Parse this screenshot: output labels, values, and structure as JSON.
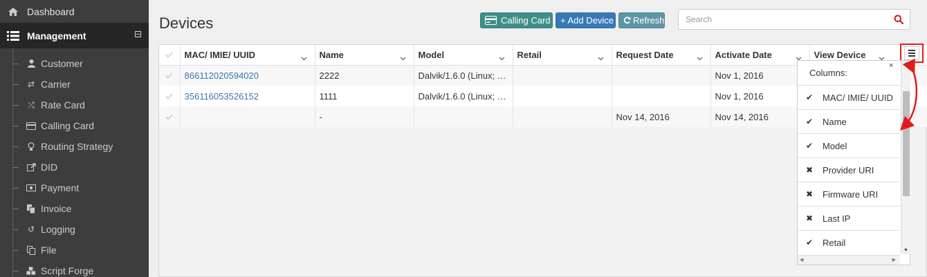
{
  "sidebar": {
    "dashboard_label": "Dashboard",
    "management_label": "Management",
    "items": [
      {
        "label": "Customer",
        "icon": "user-icon"
      },
      {
        "label": "Carrier",
        "icon": "exchange-icon"
      },
      {
        "label": "Rate Card",
        "icon": "shuffle-icon"
      },
      {
        "label": "Calling Card",
        "icon": "credit-card-icon"
      },
      {
        "label": "Routing Strategy",
        "icon": "lightbulb-icon"
      },
      {
        "label": "DID",
        "icon": "share-icon"
      },
      {
        "label": "Payment",
        "icon": "money-icon"
      },
      {
        "label": "Invoice",
        "icon": "files-icon"
      },
      {
        "label": "Logging",
        "icon": "undo-icon"
      },
      {
        "label": "File",
        "icon": "copy-icon"
      },
      {
        "label": "Script Forge",
        "icon": "cubes-icon"
      }
    ]
  },
  "page": {
    "title": "Devices"
  },
  "toolbar": {
    "calling_card_label": "Calling Card",
    "add_device_label": "+ Add Device",
    "refresh_label": "Refresh"
  },
  "search": {
    "placeholder": "Search",
    "value": ""
  },
  "grid": {
    "columns": [
      "MAC/ IMIE/ UUID",
      "Name",
      "Model",
      "Retail",
      "Request Date",
      "Activate Date",
      "View Device"
    ],
    "rows": [
      [
        "866112020594020",
        "2222",
        "Dalvik/1.6.0 (Linux; …",
        "",
        "",
        "Nov 1, 2016",
        ""
      ],
      [
        "356116053526152",
        "1111",
        "Dalvik/1.6.0 (Linux; …",
        "",
        "",
        "Nov 1, 2016",
        ""
      ],
      [
        "",
        "-",
        "",
        "",
        "Nov 14, 2016",
        "Nov 14, 2016",
        ""
      ]
    ]
  },
  "column_menu": {
    "header": "Columns:",
    "close_label": "×",
    "items": [
      {
        "label": "MAC/ IMIE/ UUID",
        "checked": true
      },
      {
        "label": "Name",
        "checked": true
      },
      {
        "label": "Model",
        "checked": true
      },
      {
        "label": "Provider URI",
        "checked": false
      },
      {
        "label": "Firmware URI",
        "checked": false
      },
      {
        "label": "Last IP",
        "checked": false
      },
      {
        "label": "Retail",
        "checked": true
      }
    ]
  },
  "colors": {
    "sidebar_bg": "#3d3d3d",
    "sidebar_active_bg": "#262626",
    "calling_card_btn": "#3f8f89",
    "add_device_btn": "#3779b7",
    "refresh_btn": "#5d96a5",
    "link": "#3a77b0",
    "highlight_red": "#e01c1c"
  }
}
